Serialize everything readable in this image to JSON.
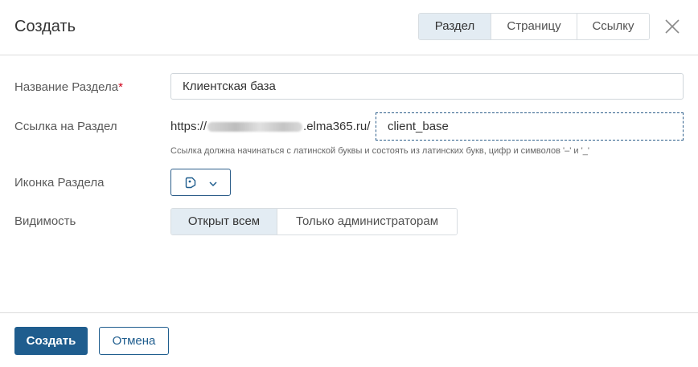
{
  "dialog": {
    "title": "Создать",
    "type_tabs": [
      {
        "label": "Раздел",
        "active": true
      },
      {
        "label": "Страницу",
        "active": false
      },
      {
        "label": "Ссылку",
        "active": false
      }
    ],
    "close_icon": "close-x-icon"
  },
  "form": {
    "name": {
      "label": "Название Раздела",
      "required_mark": "*",
      "value": "Клиентская база"
    },
    "link": {
      "label": "Ссылка на Раздел",
      "prefix_start": "https://",
      "prefix_end": ".elma365.ru/",
      "value": "client_base",
      "hint": "Ссылка должна начинаться с латинской буквы и состоять из латинских букв, цифр и символов '–' и '_'"
    },
    "icon": {
      "label": "Иконка Раздела",
      "selected_icon": "tag-icon",
      "dropdown_icon": "chevron-down-icon"
    },
    "visibility": {
      "label": "Видимость",
      "options": [
        {
          "label": "Открыт всем",
          "active": true
        },
        {
          "label": "Только администраторам",
          "active": false
        }
      ]
    }
  },
  "footer": {
    "create_label": "Создать",
    "cancel_label": "Отмена"
  },
  "colors": {
    "primary": "#1f5d8e",
    "active_tab_bg": "#e3ecf3",
    "required": "#d0021b",
    "border": "#cfd5da"
  }
}
